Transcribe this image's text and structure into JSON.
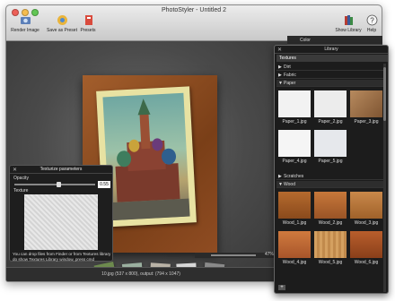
{
  "window": {
    "title": "PhotoStyler - Untitled 2"
  },
  "toolbar": {
    "render_label": "Render Image",
    "save_preset_label": "Save as Preset",
    "presets_label": "Presets",
    "show_library_label": "Show Library",
    "help_label": "Help"
  },
  "color_panel": {
    "label": "Color"
  },
  "texturize": {
    "title": "Texturize parameters",
    "opacity_label": "Opacity",
    "opacity_value": "0.55",
    "texture_label": "Texture",
    "note": "You can drop files from Finder or from Textures library do show Textures Library window, press cmd"
  },
  "zoom": {
    "value": "47%"
  },
  "status": {
    "text": "10.jpg (537 x 800), output: (794 x 1047)"
  },
  "library": {
    "title": "Library",
    "top_label": "Textures",
    "sections": [
      "Dirt",
      "Fabric",
      "Paper",
      "Scratches",
      "Wood"
    ],
    "paper_items": [
      "Paper_1.jpg",
      "Paper_2.jpg",
      "Paper_3.jpg",
      "Paper_4.jpg",
      "Paper_5.jpg"
    ],
    "wood_items": [
      "Wood_1.jpg",
      "Wood_2.jpg",
      "Wood_3.jpg",
      "Wood_4.jpg",
      "Wood_5.jpg",
      "Wood_6.jpg"
    ]
  },
  "colors": {
    "accent": "#3d3d3d",
    "photo_border": "#e8e2a2",
    "wood": "#a35e2c"
  }
}
